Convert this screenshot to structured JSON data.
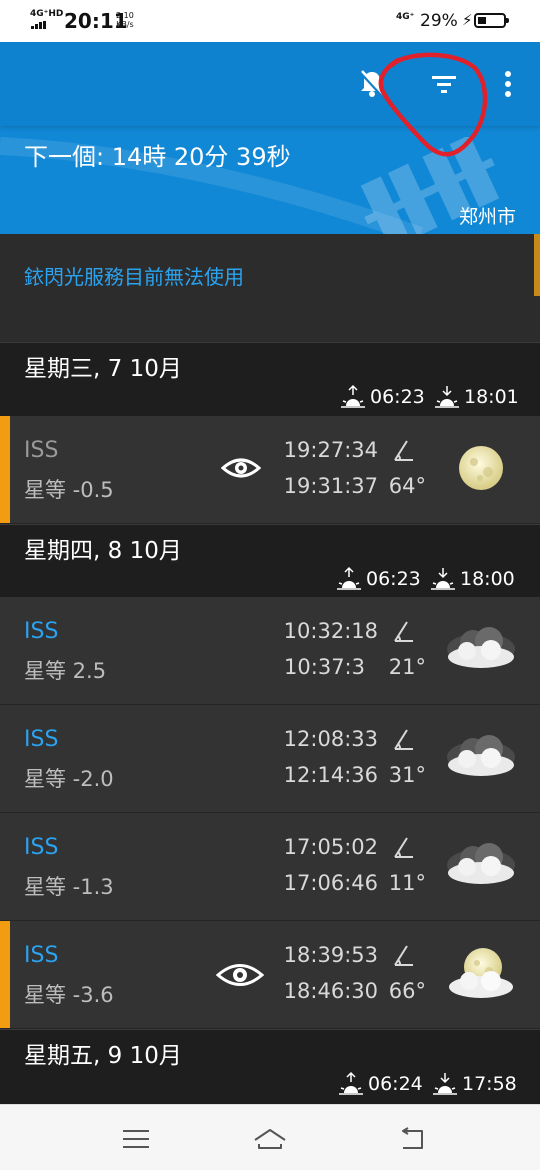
{
  "status_bar": {
    "network": "4G⁺HD",
    "time": "20:11",
    "speed_value": "2.10",
    "speed_unit": "KB/s",
    "network2": "4G⁺",
    "battery": "29%"
  },
  "header": {
    "next_label": "下一個: 14時 20分 39秒",
    "city": "郑州市",
    "icons": [
      "notifications-off-icon",
      "filter-icon",
      "more-vert-icon"
    ]
  },
  "banner": {
    "text": "銥閃光服務目前無法使用"
  },
  "days": [
    {
      "title": "星期三, 7 10月",
      "sunrise": "06:23",
      "sunset": "18:01"
    },
    {
      "title": "星期四, 8 10月",
      "sunrise": "06:23",
      "sunset": "18:00"
    },
    {
      "title": "星期五, 9 10月",
      "sunrise": "06:24",
      "sunset": "17:58"
    }
  ],
  "passes": [
    {
      "name": "ISS",
      "magnitude": "星等 -0.5",
      "start": "19:27:34",
      "end": "19:31:37",
      "elevation": "64°",
      "visible": true,
      "weather": "moon-icon"
    },
    {
      "name": "ISS",
      "magnitude": "星等 2.5",
      "start": "10:32:18",
      "end": "10:37:3",
      "elevation": "21°",
      "visible": false,
      "weather": "cloud-icon"
    },
    {
      "name": "ISS",
      "magnitude": "星等 -2.0",
      "start": "12:08:33",
      "end": "12:14:36",
      "elevation": "31°",
      "visible": false,
      "weather": "cloud-icon"
    },
    {
      "name": "ISS",
      "magnitude": "星等 -1.3",
      "start": "17:05:02",
      "end": "17:06:46",
      "elevation": "11°",
      "visible": false,
      "weather": "cloud-icon"
    },
    {
      "name": "ISS",
      "magnitude": "星等 -3.6",
      "start": "18:39:53",
      "end": "18:46:30",
      "elevation": "66°",
      "visible": true,
      "weather": "moon-cloud-icon"
    }
  ],
  "colors": {
    "header_blue": "#1188d6",
    "accent_blue": "#2aa3f0",
    "visible_orange": "#f39c12",
    "annotation_red": "#e0202a"
  },
  "navbar": [
    "menu-icon",
    "home-icon",
    "back-icon"
  ]
}
